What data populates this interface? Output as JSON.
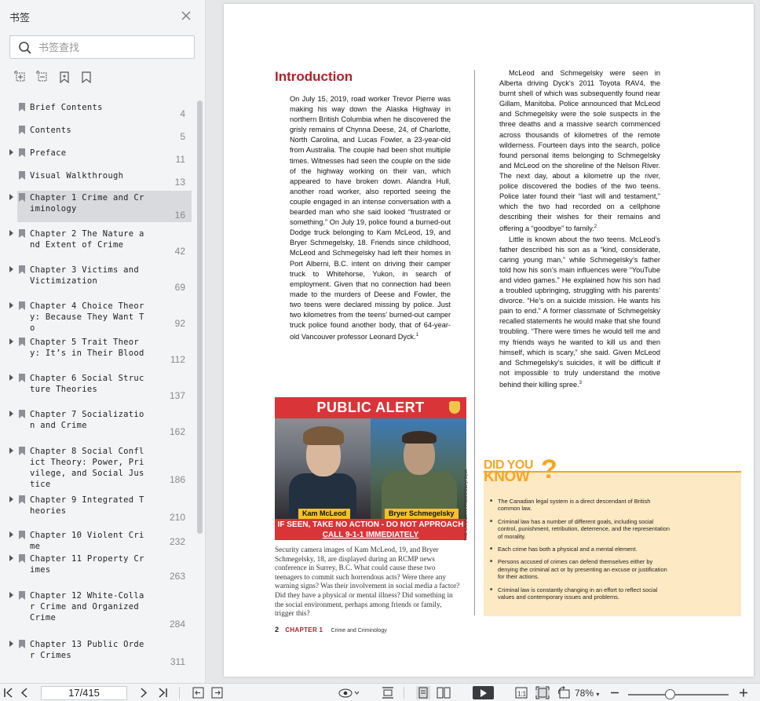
{
  "sidebar": {
    "title": "书签",
    "search_placeholder": "书签查找",
    "items": [
      {
        "label": "Brief Contents",
        "page": "4",
        "expandable": false,
        "active": false
      },
      {
        "label": "Contents",
        "page": "5",
        "expandable": false,
        "active": false
      },
      {
        "label": "Preface",
        "page": "11",
        "expandable": true,
        "active": false
      },
      {
        "label": "Visual Walkthrough",
        "page": "13",
        "expandable": false,
        "active": false
      },
      {
        "label": "Chapter 1 Crime and Criminology",
        "page": "16",
        "expandable": true,
        "active": true
      },
      {
        "label": "Chapter 2 The Nature and Extent of Crime",
        "page": "42",
        "expandable": true,
        "active": false
      },
      {
        "label": "Chapter 3 Victims and Victimization",
        "page": "69",
        "expandable": true,
        "active": false
      },
      {
        "label": "Chapter 4 Choice Theory: Because They Want To",
        "page": "92",
        "expandable": true,
        "active": false
      },
      {
        "label": "Chapter 5 Trait Theory: It’s in Their Blood",
        "page": "112",
        "expandable": true,
        "active": false
      },
      {
        "label": "Chapter 6 Social Structure Theories",
        "page": "137",
        "expandable": true,
        "active": false
      },
      {
        "label": "Chapter 7 Socialization and Crime",
        "page": "162",
        "expandable": true,
        "active": false
      },
      {
        "label": "Chapter 8 Social Conflict Theory: Power, Privilege, and Social Justice",
        "page": "186",
        "expandable": true,
        "active": false
      },
      {
        "label": "Chapter 9 Integrated Theories",
        "page": "210",
        "expandable": true,
        "active": false
      },
      {
        "label": "Chapter 10 Violent Crime",
        "page": "232",
        "expandable": true,
        "active": false
      },
      {
        "label": "Chapter 11 Property Crimes",
        "page": "263",
        "expandable": true,
        "active": false
      },
      {
        "label": "Chapter 12 White-Collar Crime and Organized Crime",
        "page": "284",
        "expandable": true,
        "active": false
      },
      {
        "label": "Chapter 13 Public Order Crimes",
        "page": "311",
        "expandable": true,
        "active": false
      }
    ]
  },
  "page": {
    "heading": "Introduction",
    "col1": "On July 15, 2019, road worker Trevor Pierre was making his way down the Alaska Highway in northern British Columbia when he discovered the grisly remains of Chynna Deese, 24, of Charlotte, North Carolina, and Lucas Fowler, a 23-year-old from Australia. The couple had been shot multiple times. Witnesses had seen the couple on the side of the highway working on their van, which appeared to have broken down. Alandra Hull, another road worker, also reported seeing the couple engaged in an intense conversation with a bearded man who she said looked “frustrated or something.” On July 19, police found a burned-out Dodge truck belonging to Kam McLeod, 19, and Bryer Schmegelsky, 18. Friends since childhood, McLeod and Schmegelsky had left their homes in Port Alberni, B.C. intent on driving their camper truck to Whitehorse, Yukon, in search of employment. Given that no connection had been made to the murders of Deese and Fowler, the two teens were declared missing by police. Just two kilometres from the teens’ burned-out camper truck police found another body, that of 64-year-old Vancouver professor Leonard Dyck.",
    "col1_footnote": "1",
    "col2_p1": "McLeod and Schmegelsky were seen in Alberta driving Dyck’s 2011 Toyota RAV4, the burnt shell of which was subsequently found near Gillam, Manitoba. Police announced that McLeod and Schmegelsky were the sole suspects in the three deaths and a massive search commenced across thousands of kilometres of the remote wilderness. Fourteen days into the search, police found personal items belonging to Schmegelsky and McLeod on the shoreline of the Nelson River. The next day, about a kilometre up the river, police discovered the bodies of the two teens. Police later found their “last will and testament,” which the two had recorded on a cellphone describing their wishes for their remains and offering a “goodbye” to family.",
    "col2_p1_footnote": "2",
    "col2_p2": "Little is known about the two teens. McLeod’s father described his son as a “kind, considerate, caring young man,” while Schmegelsky’s father told how his son’s main influences were “YouTube and video games.” He explained how his son had a troubled upbringing, struggling with his parents’ divorce. “He’s on a suicide mission. He wants his pain to end.” A former classmate of Schmegelsky recalled statements he would make that she found troubling. “There were times he would tell me and my friends ways he wanted to kill us and then himself, which is scary,” she said. Given McLeod and Schmegelsky’s suicides, it will be difficult if not impossible to truly understand the motive behind their killing spree.",
    "col2_p2_footnote": "3",
    "alert": {
      "banner": "PUBLIC ALERT",
      "name_left": "Kam McLeod",
      "name_right": "Bryer Schmegelsky",
      "warning_line1": "IF SEEN, TAKE NO ACTION - DO NOT APPROACH",
      "warning_line2": "CALL 9-1-1 IMMEDIATELY",
      "credit": "THE CANADIAN PRESS/Darryl Dyck"
    },
    "caption": "Security camera images of Kam McLeod, 19, and Bryer Schmegelsky, 18, are displayed during an RCMP news conference in Surrey, B.C. What could cause these two teenagers to commit such horrendous acts? Were there any warning signs? Was their involvement in social media a factor? Did they have a physical or mental illness? Did something in the social environment, perhaps among friends or family, trigger this?",
    "folio": {
      "number": "2",
      "chapter": "CHAPTER 1",
      "book": "Crime and Criminology"
    },
    "dyk": {
      "title_line1": "DID YOU",
      "title_line2": "KNOW",
      "title_mark": "?",
      "items": [
        "The Canadian legal system is a direct descendant of British common law.",
        "Criminal law has a number of different goals, including social control, punishment, retribution, deterrence, and the representation of morality.",
        "Each crime has both a physical and a mental element.",
        "Persons accused of crimes can defend themselves either by denying the criminal act or by presenting an excuse or justification for their actions.",
        "Criminal law is constantly changing in an effort to reflect social values and contemporary issues and problems."
      ]
    }
  },
  "toolbar": {
    "page_indicator": "17/415",
    "zoom": "78%"
  },
  "colors": {
    "accent_red": "#b31f2a",
    "dyk_orange": "#f5a623",
    "dyk_bg": "#fde9c3",
    "alert_red": "#d93539"
  }
}
